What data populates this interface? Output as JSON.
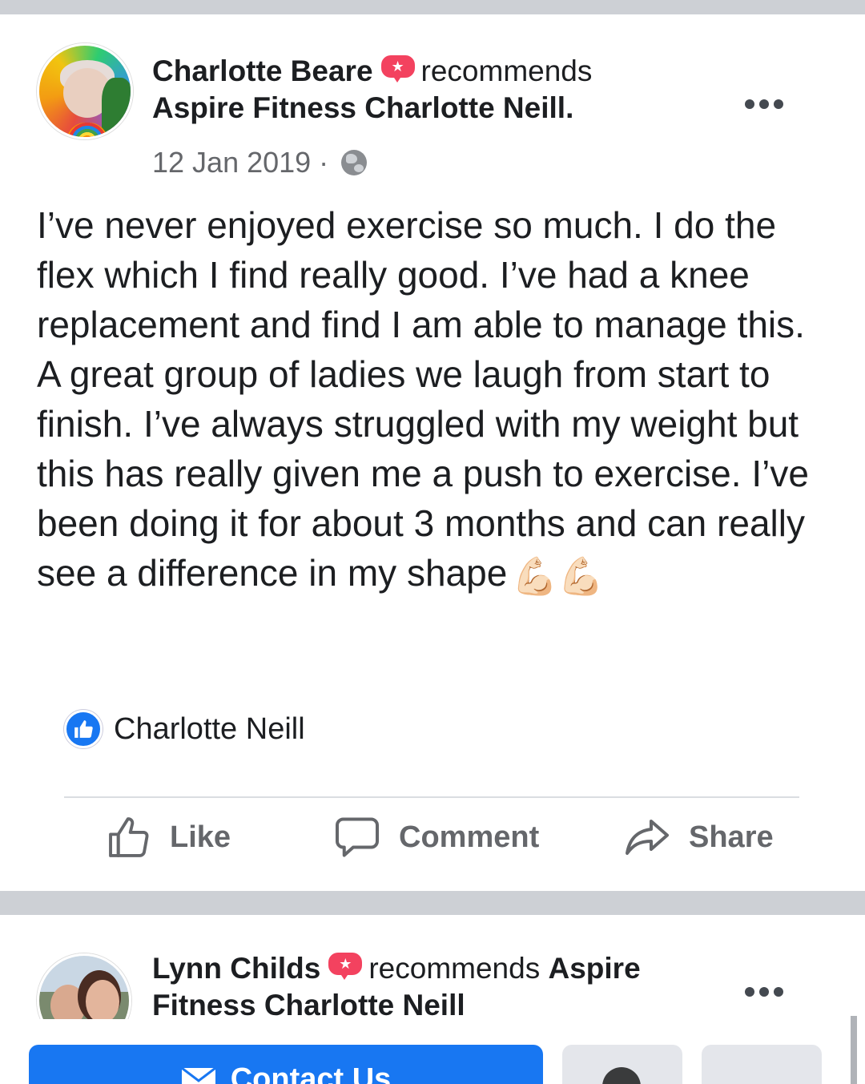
{
  "post": {
    "author": "Charlotte Beare",
    "recommends_label": "recommends",
    "page_name": "Aspire Fitness Charlotte Neill.",
    "date": "12 Jan 2019 ·",
    "body": "I’ve never enjoyed exercise so much. I do the flex which I find really good. I’ve had a knee replacement and find I am able to manage this. A great group of ladies we laugh from start to finish. I’ve always struggled with my weight but this has really given me a push to exercise. I’ve been doing it for about 3 months and can really see a difference in my shape",
    "emoji": "💪🏻💪🏻",
    "liked_by": "Charlotte Neill",
    "actions": {
      "like": "Like",
      "comment": "Comment",
      "share": "Share"
    },
    "icons": [
      "recommend-icon",
      "globe-icon",
      "more-icon",
      "like-badge-icon",
      "thumbs-up-icon",
      "comment-icon",
      "share-icon"
    ]
  },
  "post2": {
    "author": "Lynn Childs",
    "recommends_label": "recommends",
    "page_name_part1": "Aspire",
    "page_name_part2": "Fitness Charlotte Neill"
  },
  "bottom_bar": {
    "contact_label": "Contact Us"
  },
  "colors": {
    "accent": "#1877f2",
    "recommend": "#f3425f",
    "text": "#1c1e21",
    "secondary_text": "#65676b",
    "separator": "#cdd0d5"
  }
}
